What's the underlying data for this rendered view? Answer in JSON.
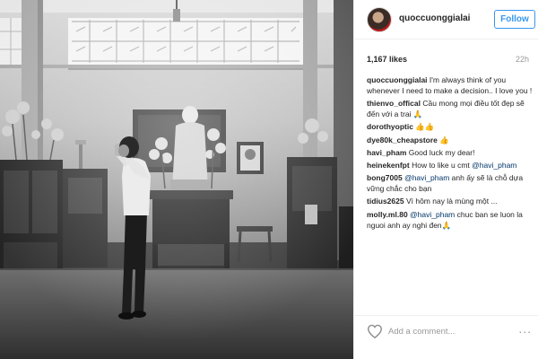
{
  "post": {
    "username": "quoccuonggialai",
    "follow_label": "Follow",
    "likes": "1,167 likes",
    "time": "22h",
    "caption": "I'm always think of you whenever I need to make a decision.. I love you !",
    "comments": [
      {
        "user": "thienvo_offical",
        "mention": "",
        "text": "Cầu mong mọi điều tốt đẹp sẽ đến với a trai 🙏"
      },
      {
        "user": "dorothyoptic",
        "mention": "",
        "text": "👍👍"
      },
      {
        "user": "dye80k_cheapstore",
        "mention": "",
        "text": "👍"
      },
      {
        "user": "havi_pham",
        "mention": "",
        "text": "Good luck my dear!"
      },
      {
        "user": "heinekenfpt",
        "mention": "@havi_pham",
        "text": "How to like u cmt"
      },
      {
        "user": "bong7005",
        "mention": "@havi_pham",
        "text": "anh ấy sẽ là chỗ dựa vững chắc cho bạn"
      },
      {
        "user": "tidius2625",
        "mention": "",
        "text": "Vì hôm nay là mùng một ..."
      },
      {
        "user": "molly.ml.80",
        "mention": "@havi_pham",
        "text": "chuc ban se luon la nguoi anh ay nghi đen🙏"
      }
    ],
    "add_comment_placeholder": "Add a comment...",
    "more_label": "..."
  },
  "icons": {
    "heart": "heart-icon",
    "avatar": "avatar",
    "more": "more-options-icon"
  },
  "colors": {
    "follow_blue": "#3897f0",
    "mention": "#003569",
    "muted": "#999999",
    "text": "#262626"
  }
}
